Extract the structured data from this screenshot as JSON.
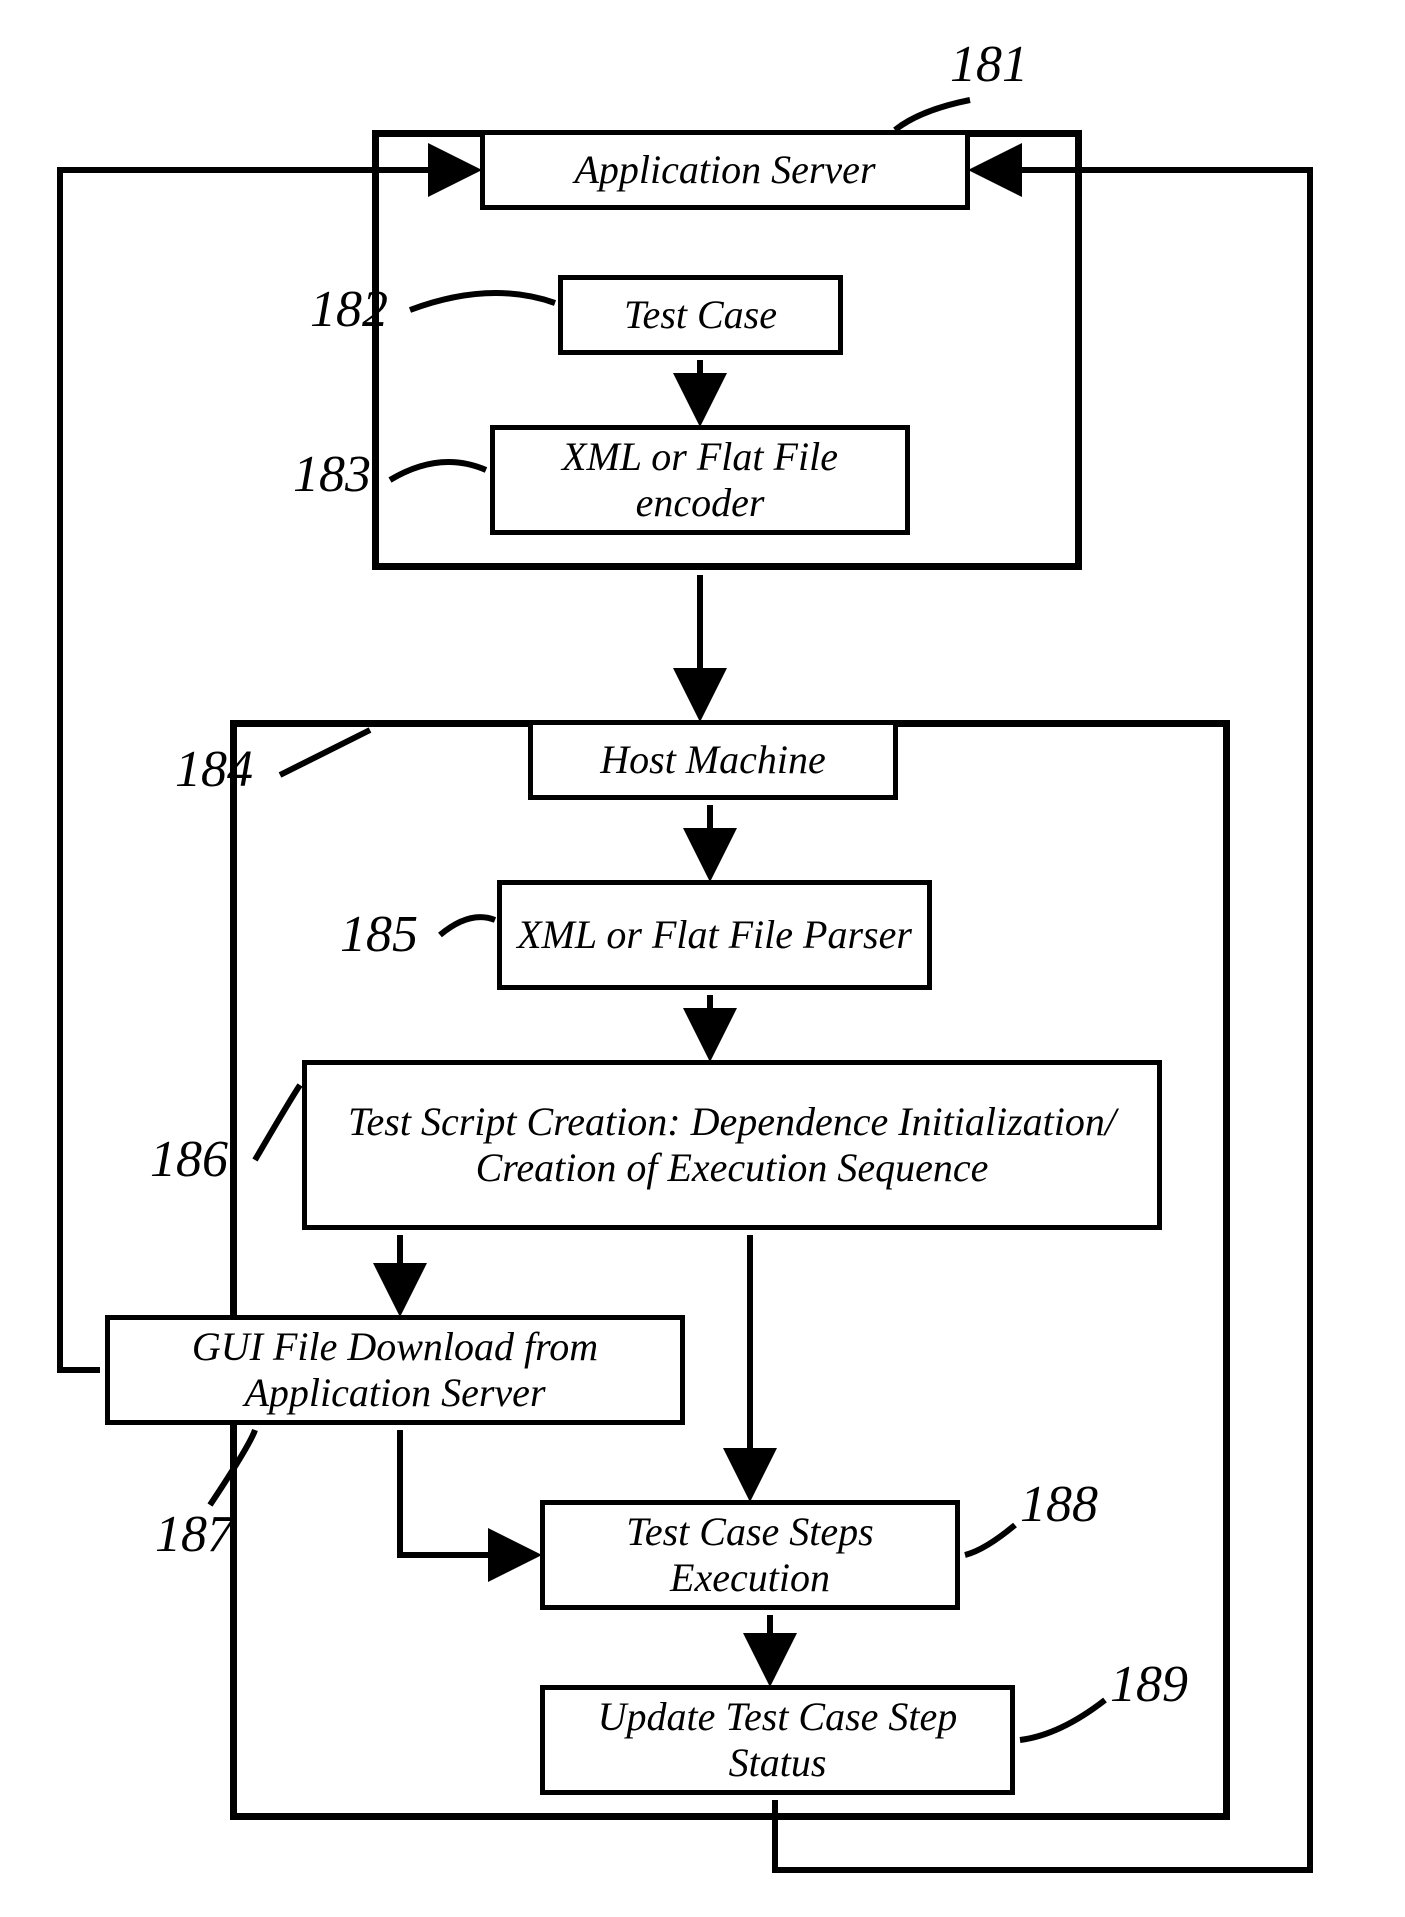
{
  "labels": {
    "l181": "181",
    "l182": "182",
    "l183": "183",
    "l184": "184",
    "l185": "185",
    "l186": "186",
    "l187": "187",
    "l188": "188",
    "l189": "189"
  },
  "boxes": {
    "app_server": "Application Server",
    "test_case": "Test Case",
    "encoder": "XML or Flat File encoder",
    "host_machine": "Host Machine",
    "parser": "XML or Flat File Parser",
    "script_creation": "Test Script Creation: Dependence Initialization/ Creation of Execution Sequence",
    "gui_download": "GUI File Download from Application Server",
    "steps_exec": "Test Case Steps Execution",
    "update_status": "Update Test Case Step Status"
  }
}
